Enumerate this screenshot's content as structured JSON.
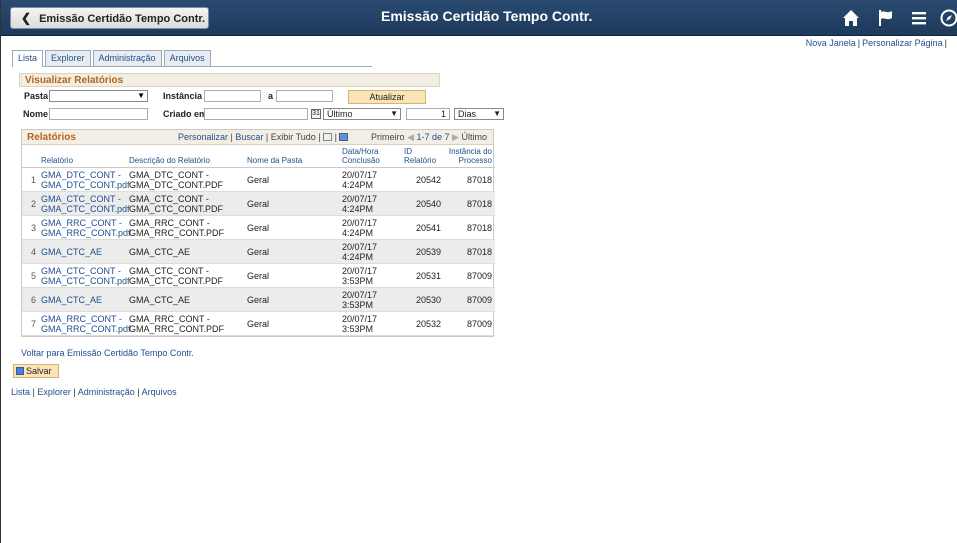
{
  "banner": {
    "back_label": "Emissão Certidão Tempo Contr.",
    "title": "Emissão Certidão Tempo Contr.",
    "icons": [
      "home-icon",
      "flag-icon",
      "menu-icon",
      "compass-icon"
    ]
  },
  "header_links": {
    "new_window": "Nova Janela",
    "personalize_page": "Personalizar Página"
  },
  "tabs": [
    {
      "label": "Lista"
    },
    {
      "label": "Explorer"
    },
    {
      "label": "Administração"
    },
    {
      "label": "Arquivos"
    }
  ],
  "search": {
    "title": "Visualizar Relatórios",
    "folder_label": "Pasta",
    "folder_value": "",
    "instance_label": "Instância",
    "instance_from": "",
    "instance_to_label": "a",
    "instance_to": "",
    "update_button": "Atualizar",
    "name_label": "Nome",
    "name_value": "",
    "created_label": "Criado em",
    "created_value": "",
    "last_select": "Último",
    "count_value": "1",
    "unit_select": "Dias"
  },
  "grid": {
    "title": "Relatórios",
    "tool_personalize": "Personalizar",
    "tool_search": "Buscar",
    "tool_view_all": "Exibir Tudo",
    "nav_first": "Primeiro",
    "nav_range": "1-7 de 7",
    "nav_last": "Último",
    "columns": {
      "report": "Relatório",
      "description": "Descrição do Relatório",
      "folder": "Nome da Pasta",
      "date": "Data/Hora Conclusão",
      "id": "ID Relatório",
      "instance": "Instância do Processo"
    },
    "rows": [
      {
        "idx": "1",
        "report": "GMA_DTC_CONT - GMA_DTC_CONT.pdf",
        "desc": "GMA_DTC_CONT - GMA_DTC_CONT.PDF",
        "folder": "Geral",
        "date": "20/07/17 4:24PM",
        "id": "20542",
        "instance": "87018"
      },
      {
        "idx": "2",
        "report": "GMA_CTC_CONT - GMA_CTC_CONT.pdf",
        "desc": "GMA_CTC_CONT - GMA_CTC_CONT.PDF",
        "folder": "Geral",
        "date": "20/07/17 4:24PM",
        "id": "20540",
        "instance": "87018"
      },
      {
        "idx": "3",
        "report": "GMA_RRC_CONT - GMA_RRC_CONT.pdf",
        "desc": "GMA_RRC_CONT - GMA_RRC_CONT.PDF",
        "folder": "Geral",
        "date": "20/07/17 4:24PM",
        "id": "20541",
        "instance": "87018"
      },
      {
        "idx": "4",
        "report": "GMA_CTC_AE",
        "desc": "GMA_CTC_AE",
        "folder": "Geral",
        "date": "20/07/17 4:24PM",
        "id": "20539",
        "instance": "87018"
      },
      {
        "idx": "5",
        "report": "GMA_CTC_CONT - GMA_CTC_CONT.pdf",
        "desc": "GMA_CTC_CONT - GMA_CTC_CONT.PDF",
        "folder": "Geral",
        "date": "20/07/17 3:53PM",
        "id": "20531",
        "instance": "87009"
      },
      {
        "idx": "6",
        "report": "GMA_CTC_AE",
        "desc": "GMA_CTC_AE",
        "folder": "Geral",
        "date": "20/07/17 3:53PM",
        "id": "20530",
        "instance": "87009"
      },
      {
        "idx": "7",
        "report": "GMA_RRC_CONT - GMA_RRC_CONT.pdf",
        "desc": "GMA_RRC_CONT - GMA_RRC_CONT.PDF",
        "folder": "Geral",
        "date": "20/07/17 3:53PM",
        "id": "20532",
        "instance": "87009"
      }
    ]
  },
  "back_link": "Voltar para Emissão Certidão Tempo Contr.",
  "save_button": "Salvar",
  "bottom_links": [
    "Lista",
    "Explorer",
    "Administração",
    "Arquivos"
  ]
}
